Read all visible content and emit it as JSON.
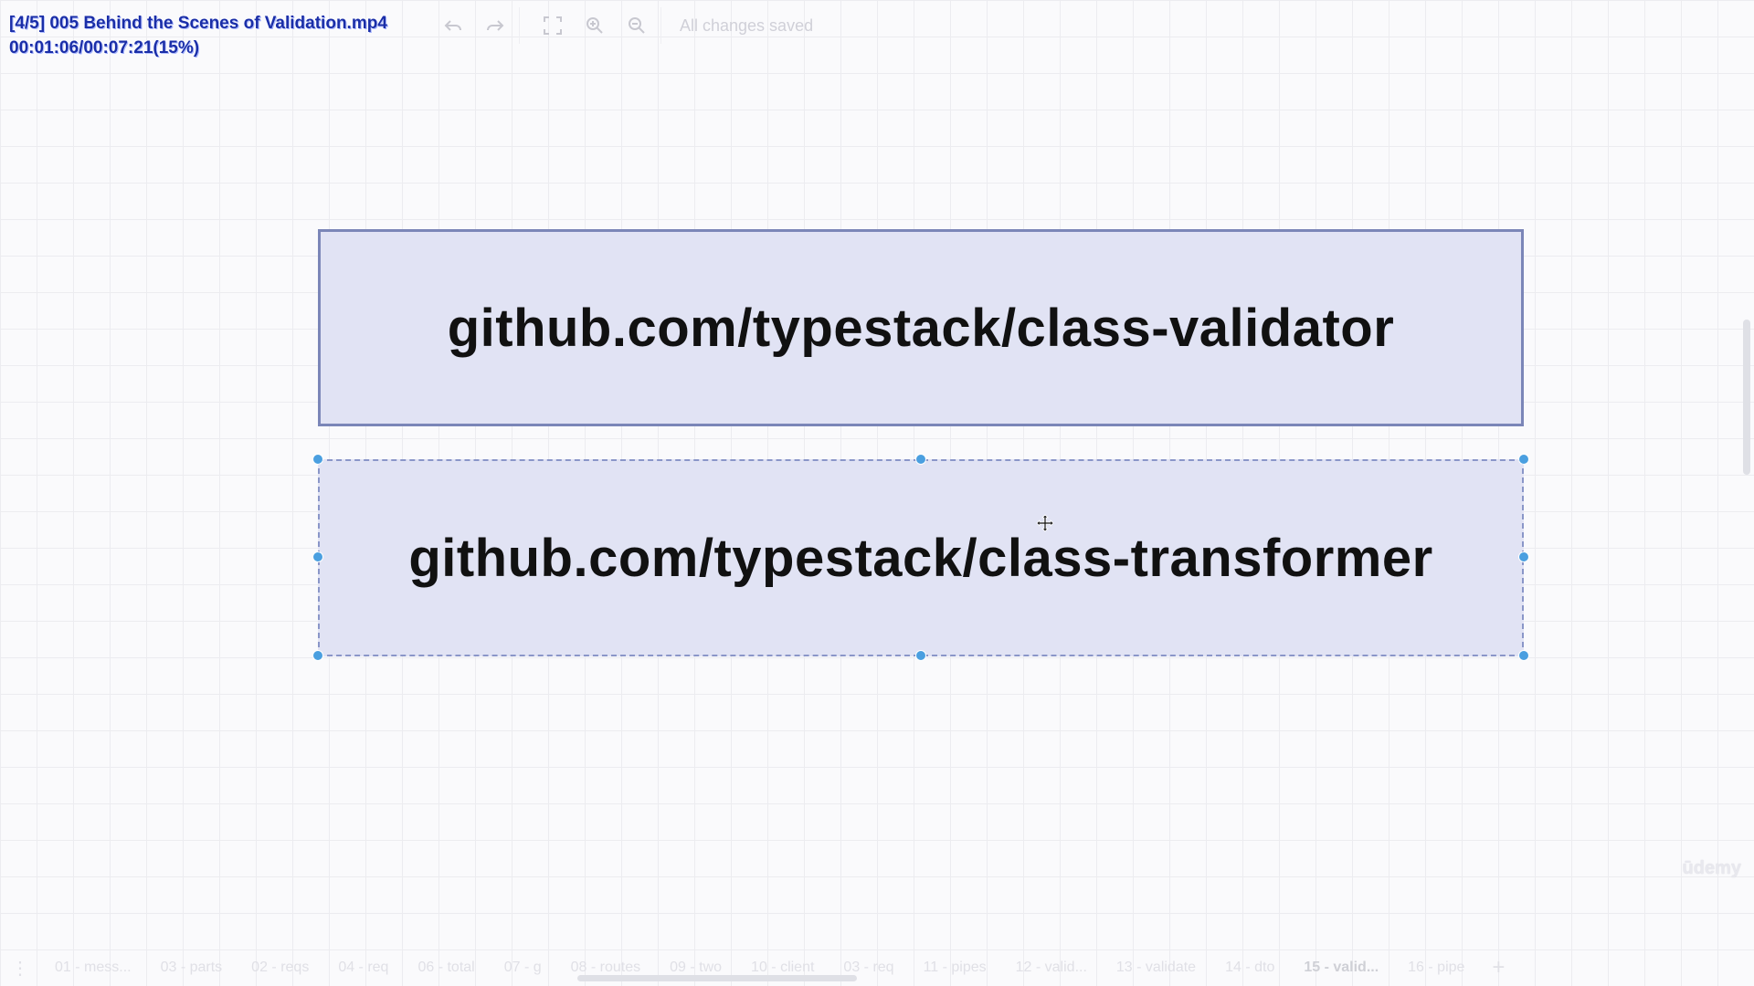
{
  "overlay": {
    "filename": "[4/5] 005 Behind the Scenes of Validation.mp4",
    "progress": "00:01:06/00:07:21(15%)"
  },
  "toolbar": {
    "undo_icon": "undo-icon",
    "redo_icon": "redo-icon",
    "fullscreen_icon": "fullscreen-icon",
    "zoom_in_icon": "zoom-in-icon",
    "zoom_out_icon": "zoom-out-icon",
    "status": "All changes saved"
  },
  "canvas": {
    "shape1_text": "github.com/typestack/class-validator",
    "shape2_text": "github.com/typestack/class-transformer",
    "shape_fill": "#e1e3f4",
    "shape_border": "#7b86b8",
    "handle_color": "#4a9fe0"
  },
  "watermark": "ūdemy",
  "pages": {
    "tabs": [
      "01 - mess...",
      "03 - parts",
      "02 - reqs",
      "04 - req",
      "06 - total",
      "07 - g",
      "08 - routes",
      "09 - two",
      "10 - client",
      "03 - req",
      "11 - pipes",
      "12 - valid...",
      "13 - validate",
      "14 - dto",
      "15 - valid...",
      "16 - pipe"
    ],
    "active_index": 14
  }
}
